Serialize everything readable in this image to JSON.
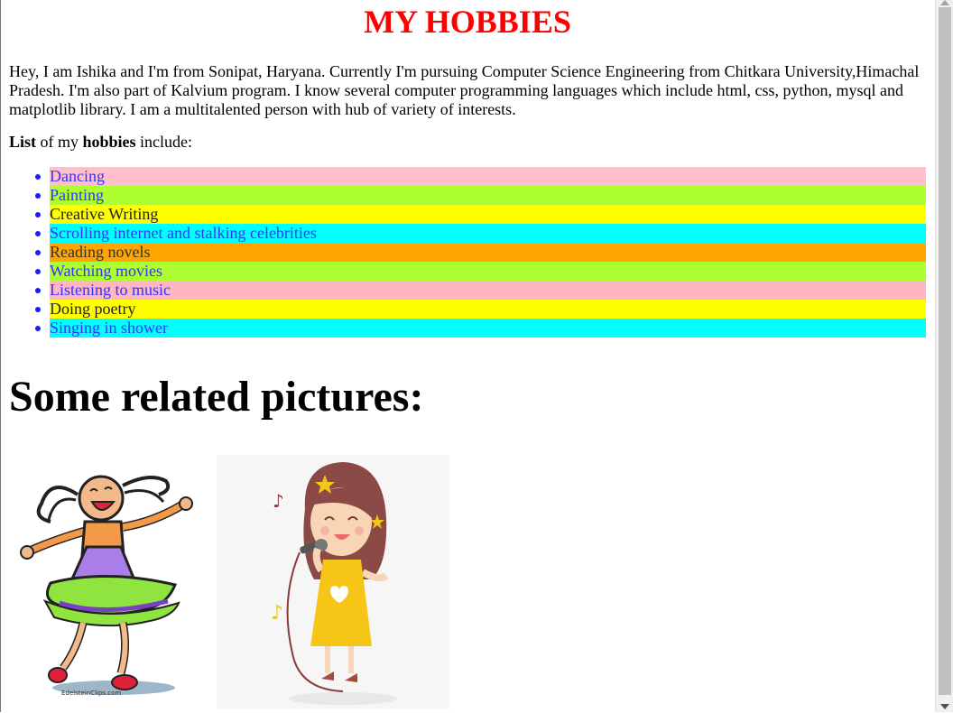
{
  "page": {
    "title": "MY HOBBIES",
    "intro": "Hey, I am Ishika and I'm from Sonipat, Haryana. Currently I'm pursuing Computer Science Engineering from Chitkara University,Himachal Pradesh. I'm also part of Kalvium program. I know several computer programming languages which include html, css, python, mysql and matplotlib library. I am a multitalented person with hub of variety of interests.",
    "list_intro": {
      "bold1": "List",
      "text1": " of my ",
      "bold2": "hobbies",
      "text2": " include:"
    },
    "hobbies": [
      {
        "label": "Dancing",
        "bg": "#ffc0cb",
        "fg": "#3333ff"
      },
      {
        "label": "Painting",
        "bg": "#adff2f",
        "fg": "#3333ff"
      },
      {
        "label": "Creative Writing",
        "bg": "#ffff00",
        "fg": "#222222"
      },
      {
        "label": "Scrolling internet and stalking celebrities",
        "bg": "#00ffff",
        "fg": "#3333ff"
      },
      {
        "label": "Reading novels",
        "bg": "#ffa500",
        "fg": "#333333"
      },
      {
        "label": "Watching movies",
        "bg": "#adff2f",
        "fg": "#3333ff"
      },
      {
        "label": "Listening to music",
        "bg": "#ffb6c1",
        "fg": "#3333ff"
      },
      {
        "label": "Doing poetry",
        "bg": "#ffff00",
        "fg": "#222222"
      },
      {
        "label": "Singing in shower",
        "bg": "#00ffff",
        "fg": "#3333ff"
      }
    ],
    "pictures_heading": "Some related pictures:",
    "picture_credit": "EdelsteinClips.com",
    "colors": {
      "title": "#ff0000",
      "bullet": "#1a1aff"
    }
  }
}
